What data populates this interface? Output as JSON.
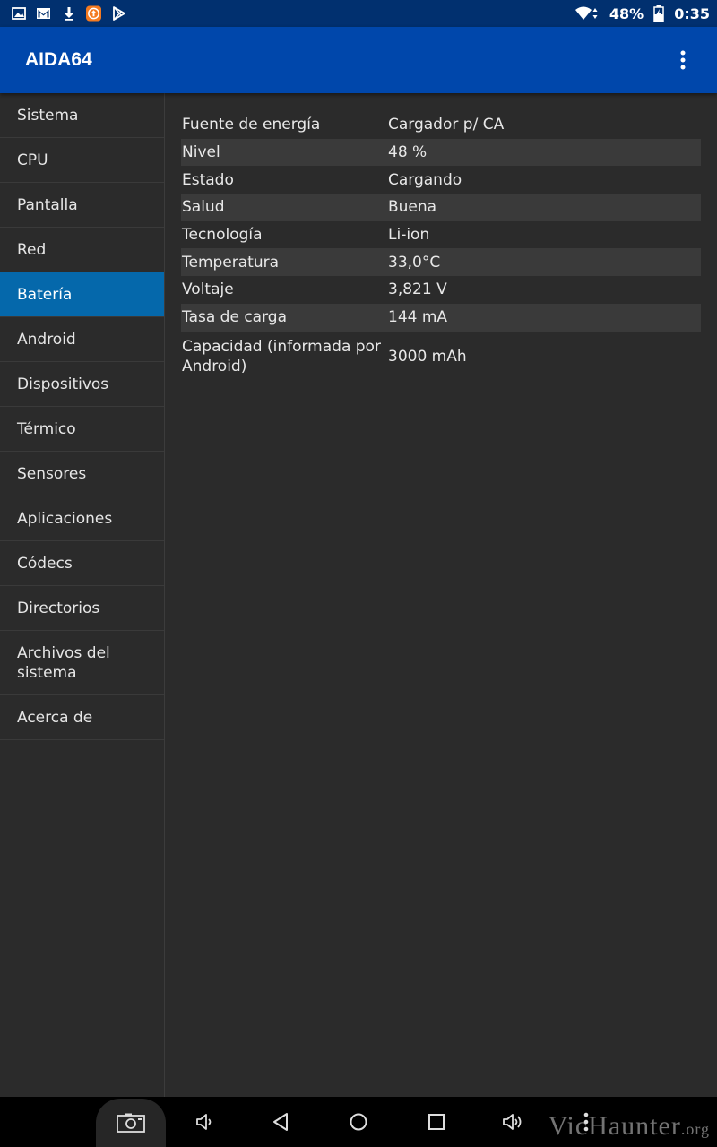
{
  "status_bar": {
    "left_icons": [
      "image-icon",
      "gmail-icon",
      "download-icon",
      "upload-app-icon",
      "play-store-icon"
    ],
    "battery_percent": "48%",
    "time": "0:35"
  },
  "app_bar": {
    "title": "AIDA64"
  },
  "sidebar": {
    "items": [
      {
        "label": "Sistema"
      },
      {
        "label": "CPU"
      },
      {
        "label": "Pantalla"
      },
      {
        "label": "Red"
      },
      {
        "label": "Batería",
        "active": true
      },
      {
        "label": "Android"
      },
      {
        "label": "Dispositivos"
      },
      {
        "label": "Térmico"
      },
      {
        "label": "Sensores"
      },
      {
        "label": "Aplicaciones"
      },
      {
        "label": "Códecs"
      },
      {
        "label": "Directorios"
      },
      {
        "label": "Archivos del sistema"
      },
      {
        "label": "Acerca de"
      }
    ]
  },
  "battery_info": {
    "rows": [
      {
        "label": "Fuente de energía",
        "value": "Cargador p/ CA"
      },
      {
        "label": "Nivel",
        "value": "48 %"
      },
      {
        "label": "Estado",
        "value": "Cargando"
      },
      {
        "label": "Salud",
        "value": "Buena"
      },
      {
        "label": "Tecnología",
        "value": "Li-ion"
      },
      {
        "label": "Temperatura",
        "value": "33,0°C"
      },
      {
        "label": "Voltaje",
        "value": "3,821 V"
      },
      {
        "label": "Tasa de carga",
        "value": "144 mA"
      },
      {
        "label": "Capacidad (informada por Android)",
        "value": "3000 mAh"
      }
    ]
  },
  "nav_bar": {
    "buttons": [
      "screenshot-icon",
      "volume-down-icon",
      "back-icon",
      "home-icon",
      "recents-icon",
      "volume-up-icon",
      "more-vert-icon"
    ]
  },
  "watermark": {
    "main": "VicHaunter",
    "suffix": ".org"
  },
  "colors": {
    "status_bar": "#01306f",
    "app_bar": "#0047ab",
    "active_item": "#0568ab",
    "background": "#2b2b2b",
    "alt_row": "#3a3a3a"
  }
}
